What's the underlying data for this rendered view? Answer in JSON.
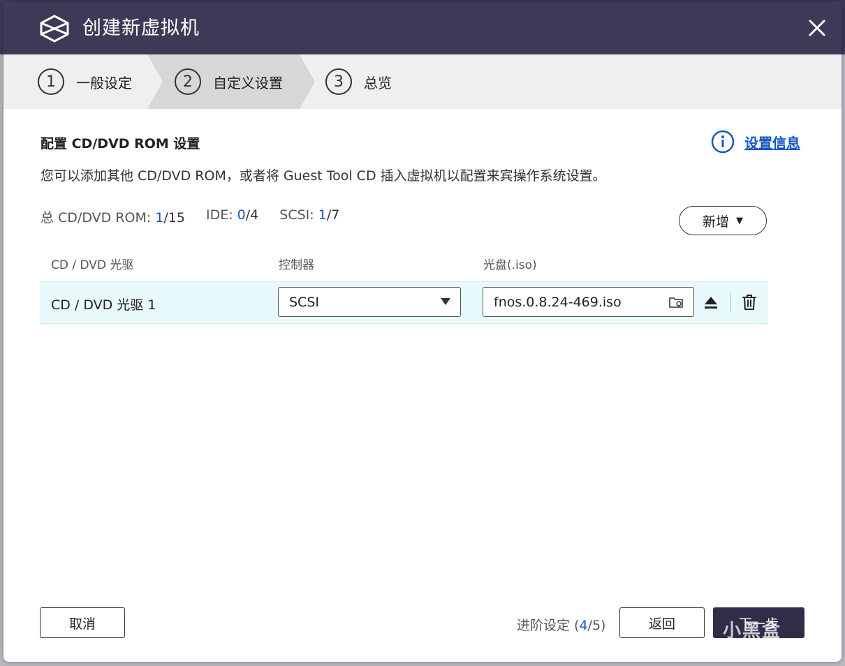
{
  "window": {
    "title": "创建新虚拟机"
  },
  "stepper": {
    "steps": [
      {
        "number": "1",
        "label": "一般设定"
      },
      {
        "number": "2",
        "label": "自定义设置"
      },
      {
        "number": "3",
        "label": "总览"
      }
    ],
    "active_index": 1
  },
  "section": {
    "title": "配置 CD/DVD ROM 设置",
    "info_link": "设置信息",
    "description": "您可以添加其他 CD/DVD ROM，或者将 Guest Tool CD 插入虚拟机以配置来宾操作系统设置。"
  },
  "counts": {
    "total_label": "总 CD/DVD ROM:",
    "total_used": "1",
    "total_max": "/15",
    "ide_label": "IDE:",
    "ide_used": "0",
    "ide_max": "/4",
    "scsi_label": "SCSI:",
    "scsi_used": "1",
    "scsi_max": "/7"
  },
  "add_button": {
    "label": "新增"
  },
  "table": {
    "columns": [
      "CD / DVD 光驱",
      "控制器",
      "光盘(.iso)"
    ],
    "rows": [
      {
        "name": "CD / DVD 光驱 1",
        "controller": "SCSI",
        "iso": "fnos.0.8.24-469.iso"
      }
    ]
  },
  "footer": {
    "cancel": "取消",
    "advanced_prefix": "进阶设定 (",
    "advanced_current": "4",
    "advanced_suffix": "/5)",
    "back": "返回",
    "next": "下一步"
  },
  "watermark": "小黑盒",
  "colors": {
    "titlebar": "#3c3a57",
    "accent_blue": "#1557c0",
    "row_highlight": "#e8fafc",
    "primary_button": "#2f2d48"
  },
  "icons": {
    "logo": "vm-cube-logo-icon",
    "close": "close-icon",
    "info": "info-circle-icon",
    "dropdown": "triangle-down-icon",
    "folder": "folder-icon",
    "eject": "eject-icon",
    "trash": "trash-icon"
  }
}
